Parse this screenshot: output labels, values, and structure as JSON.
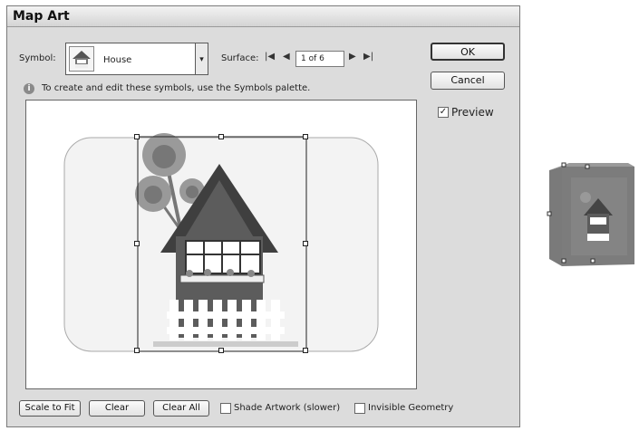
{
  "dialog": {
    "title": "Map Art"
  },
  "symbol": {
    "label": "Symbol:",
    "value": "House"
  },
  "surface": {
    "label": "Surface:",
    "value": "1 of 6"
  },
  "info": {
    "text": "To create and edit these symbols, use the Symbols palette."
  },
  "buttons": {
    "ok": "OK",
    "cancel": "Cancel",
    "scale_to_fit": "Scale to Fit",
    "clear": "Clear",
    "clear_all": "Clear All"
  },
  "options": {
    "preview": {
      "label": "Preview",
      "checked": true
    },
    "shade_artwork": {
      "label": "Shade Artwork (slower)",
      "checked": false
    },
    "invisible_geometry": {
      "label": "Invisible Geometry",
      "checked": false
    }
  },
  "icons": [
    "dropdown-arrow-icon",
    "first-surface-icon",
    "prev-surface-icon",
    "next-surface-icon",
    "last-surface-icon",
    "info-icon",
    "house-symbol-icon"
  ],
  "colors": {
    "dialog_bg": "#dcdcdc",
    "house_body": "#5c5c5c",
    "roof": "#3f3f3f",
    "tree": "#8a8a8a"
  }
}
